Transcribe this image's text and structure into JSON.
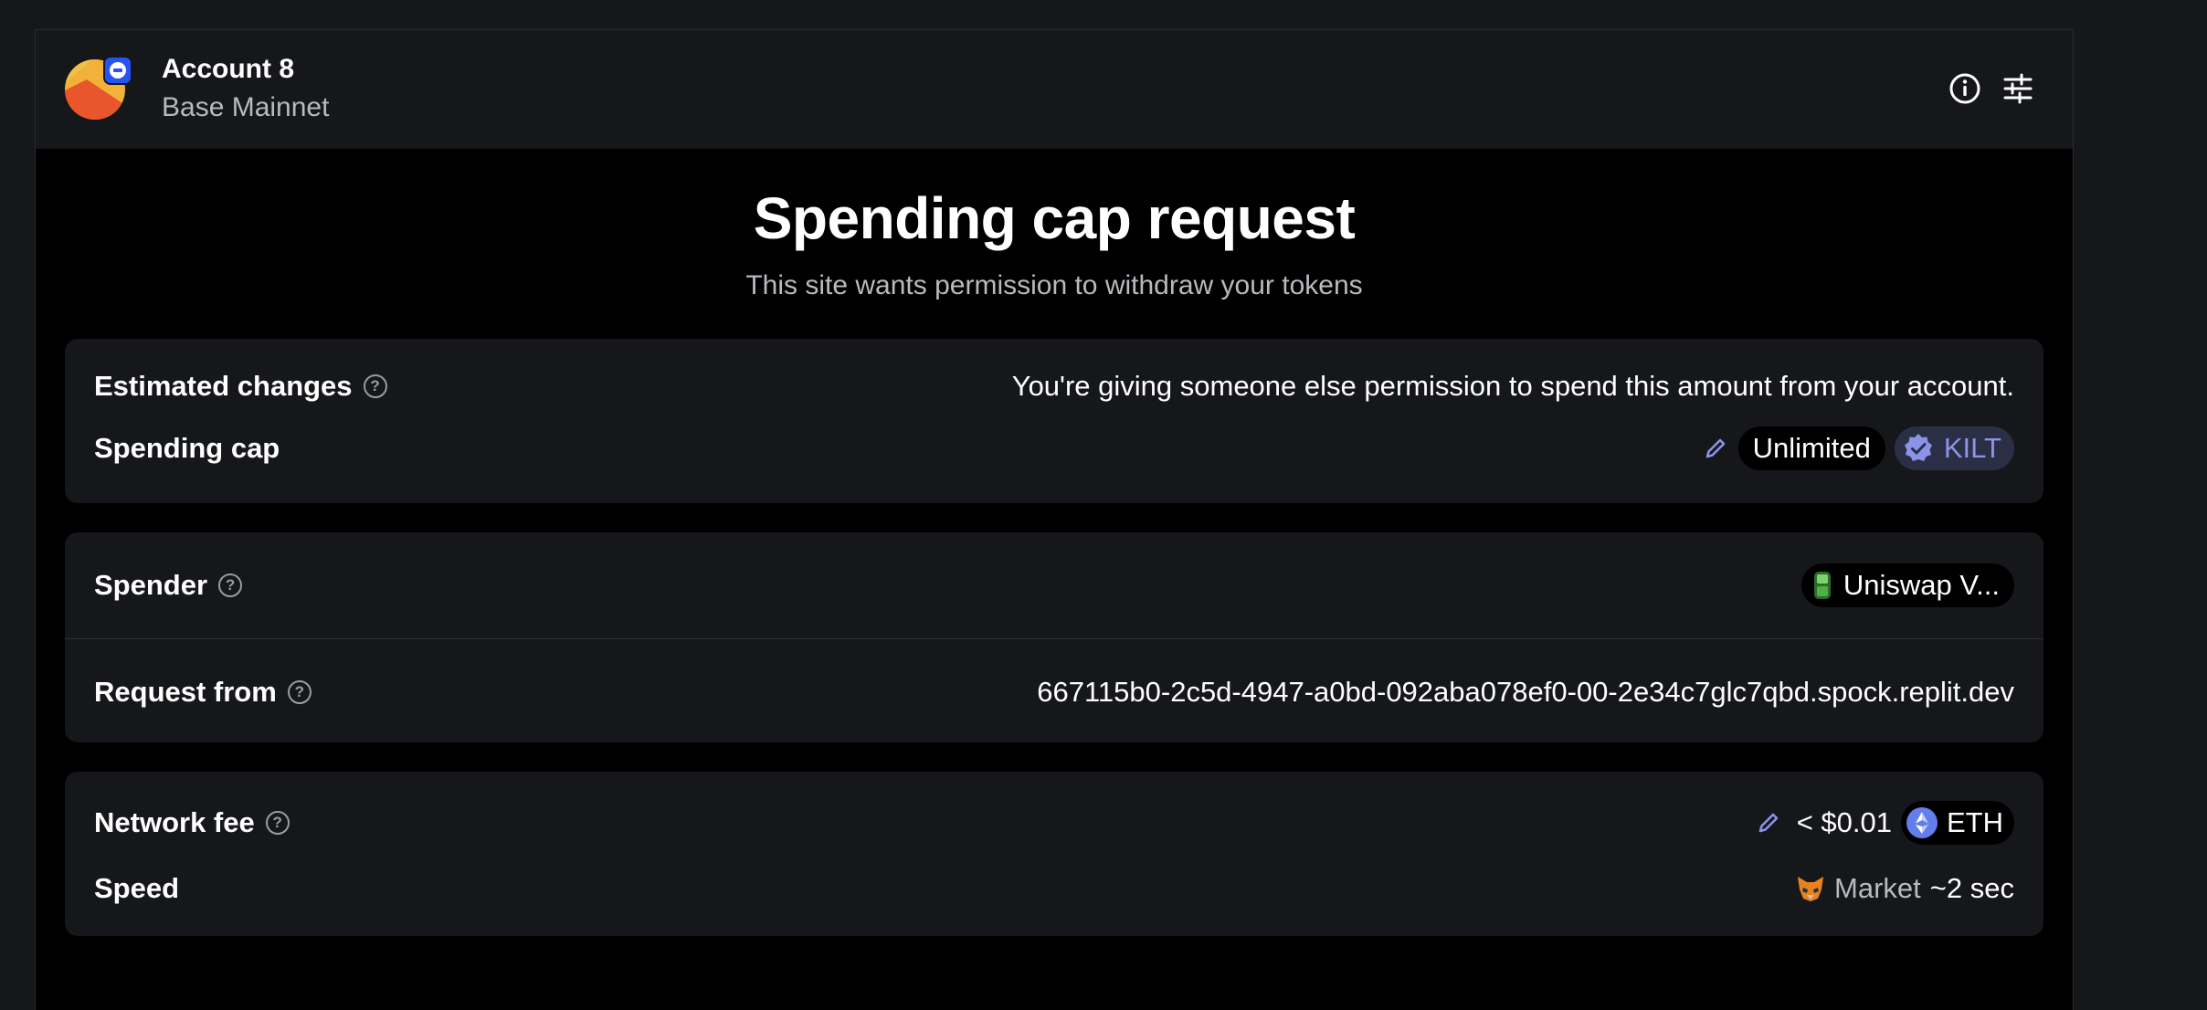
{
  "header": {
    "account_name": "Account 8",
    "network": "Base Mainnet"
  },
  "title": "Spending cap request",
  "subtitle": "This site wants permission to withdraw your tokens",
  "estimated_changes": {
    "label": "Estimated changes",
    "description": "You're giving someone else permission to spend this amount from your account.",
    "spending_cap_label": "Spending cap",
    "spending_cap_value": "Unlimited",
    "token": "KILT"
  },
  "spender": {
    "label": "Spender",
    "value": "Uniswap V..."
  },
  "request_from": {
    "label": "Request from",
    "value": "667115b0-2c5d-4947-a0bd-092aba078ef0-00-2e34c7glc7qbd.spock.replit.dev"
  },
  "network_fee": {
    "label": "Network fee",
    "value": "< $0.01",
    "token": "ETH"
  },
  "speed": {
    "label": "Speed",
    "mode": "Market",
    "time": "~2 sec"
  },
  "colors": {
    "accent": "#8b93e8",
    "card_bg": "#16171a",
    "page_bg": "#000000"
  }
}
